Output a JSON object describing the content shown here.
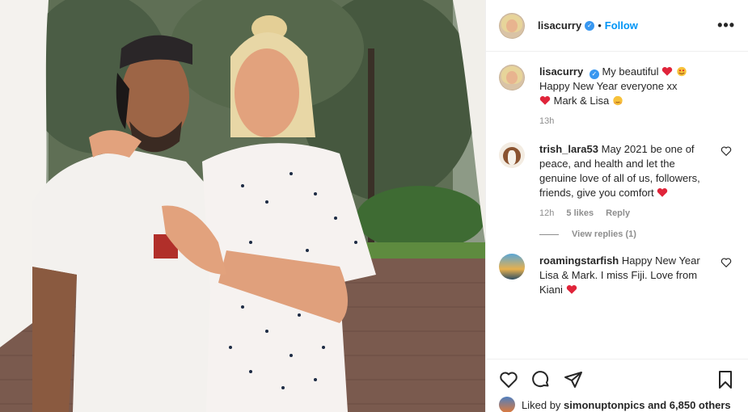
{
  "post": {
    "username": "lisacurry",
    "follow_label": "Follow",
    "separator": "•",
    "more_label": "•••"
  },
  "caption": {
    "username": "lisacurry",
    "line1": "My beautiful",
    "line2": "Happy New Year everyone xx",
    "line3": "Mark & Lisa",
    "time": "13h"
  },
  "comments": [
    {
      "username": "trish_lara53",
      "text": "May 2021 be one of peace, and health and let the genuine love of all of us, followers, friends, give you comfort",
      "time": "12h",
      "likes": "5 likes",
      "reply_label": "Reply",
      "view_replies": "View replies (1)"
    },
    {
      "username": "roamingstarfish",
      "text": "Happy New Year Lisa & Mark. I miss Fiji. Love from Kiani"
    }
  ],
  "likes": {
    "prefix": "Liked by",
    "user": "simonuptonpics",
    "suffix": "and 6,850 others"
  },
  "icons": [
    "heart-icon",
    "comment-icon",
    "share-icon",
    "bookmark-icon",
    "verified-icon",
    "more-icon"
  ],
  "colors": {
    "accent": "#0095f6",
    "verified": "#3897f0",
    "muted": "#8e8e8e",
    "heart": "#ed4956"
  }
}
